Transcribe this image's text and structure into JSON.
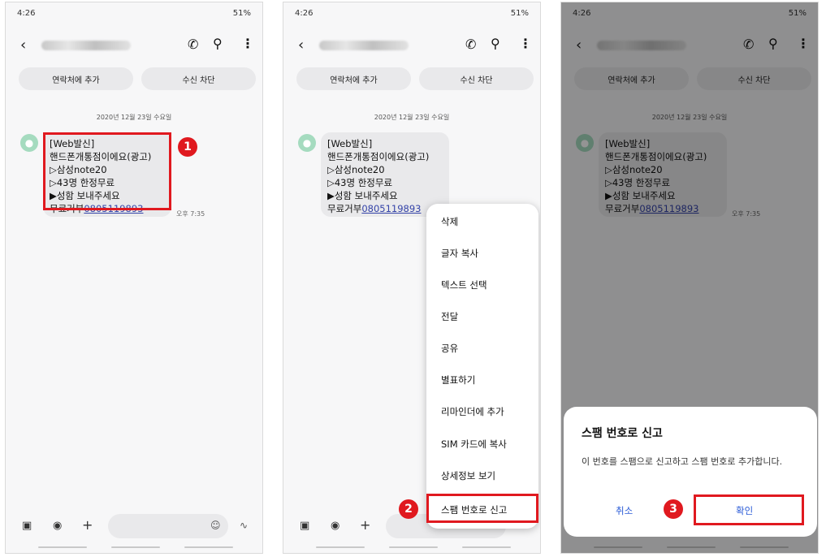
{
  "status": {
    "time": "4:26",
    "signal_battery": "51%"
  },
  "conversation": {
    "add_contact": "연락처에 추가",
    "block_number": "수신 차단",
    "date": "2020년 12월 23일 수요일",
    "message_lines": [
      "[Web발신]",
      "핸드폰개통점이에요(광고)",
      "▷삼성note20",
      "▷43명 한정무료",
      "▶성함 보내주세요"
    ],
    "optout_label": "무료거부",
    "optout_number": "0805119893",
    "message_time": "오후 7:35"
  },
  "menu": {
    "items": [
      "삭제",
      "글자 복사",
      "텍스트 선택",
      "전달",
      "공유",
      "별표하기",
      "리마인더에 추가",
      "SIM 카드에 복사",
      "상세정보 보기",
      "스팸 번호로 신고"
    ]
  },
  "dialog": {
    "title": "스팸 번호로 신고",
    "body": "이 번호를 스팸으로 신고하고 스팸 번호로 추가합니다.",
    "cancel": "취소",
    "confirm": "확인"
  },
  "steps": [
    "1",
    "2",
    "3"
  ],
  "icons": {
    "back": "back-icon",
    "call": "wifi-call-icon",
    "search": "search-icon",
    "more": "more-icon"
  },
  "colors": {
    "highlight": "#e0191f",
    "link": "#3443a8",
    "dialog_button": "#2a5bd7"
  }
}
